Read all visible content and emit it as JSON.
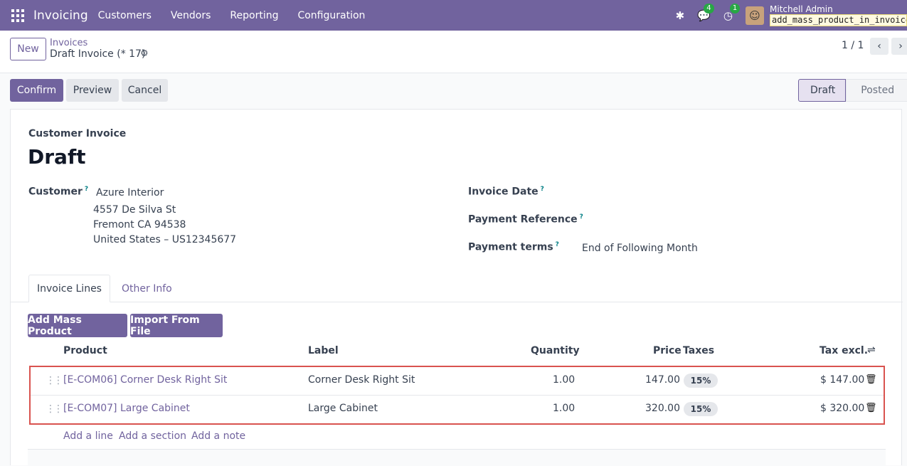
{
  "navbar": {
    "app_name": "Invoicing",
    "menu": [
      "Customers",
      "Vendors",
      "Reporting",
      "Configuration"
    ],
    "chat_count": "4",
    "activity_count": "1",
    "user_name": "Mitchell Admin",
    "db_name": "add_mass_product_in_invoice"
  },
  "control": {
    "new_label": "New",
    "breadcrumb_parent": "Invoices",
    "breadcrumb_current": "Draft Invoice (* 17)",
    "pager": "1 / 1"
  },
  "actions": {
    "confirm": "Confirm",
    "preview": "Preview",
    "cancel": "Cancel"
  },
  "statusbar": {
    "active": "Draft",
    "inactive": "Posted"
  },
  "form": {
    "subtitle": "Customer Invoice",
    "title": "Draft",
    "customer_label": "Customer",
    "customer_name": "Azure Interior",
    "address_line1": "4557 De Silva St",
    "address_line2": "Fremont CA 94538",
    "address_line3": "United States – US12345677",
    "invoice_date_label": "Invoice Date",
    "payment_reference_label": "Payment Reference",
    "payment_terms_label": "Payment terms",
    "payment_terms_value": "End of Following Month",
    "help_mark": "?"
  },
  "tabs": {
    "invoice_lines": "Invoice Lines",
    "other_info": "Other Info"
  },
  "lines": {
    "add_mass_product": "Add Mass Product",
    "import_from_file": "Import From File",
    "columns": {
      "product": "Product",
      "label": "Label",
      "quantity": "Quantity",
      "price": "Price",
      "taxes": "Taxes",
      "tax_excl": "Tax excl."
    },
    "rows": [
      {
        "product": "[E-COM06] Corner Desk Right Sit",
        "label": "Corner Desk Right Sit",
        "quantity": "1.00",
        "price": "147.00",
        "tax": "15%",
        "subtotal": "$ 147.00"
      },
      {
        "product": "[E-COM07] Large Cabinet",
        "label": "Large Cabinet",
        "quantity": "1.00",
        "price": "320.00",
        "tax": "15%",
        "subtotal": "$ 320.00"
      }
    ],
    "add_line": "Add a line",
    "add_section": "Add a section",
    "add_note": "Add a note"
  }
}
